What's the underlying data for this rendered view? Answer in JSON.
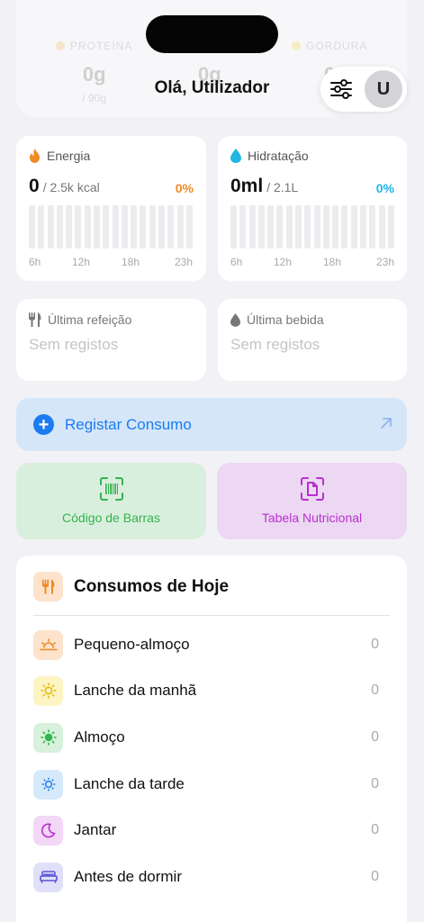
{
  "header": {
    "greeting": "Olá, Utilizador",
    "avatar_initial": "U",
    "faded_macros": [
      {
        "label": "PROTEÍNA",
        "value": "0g",
        "sub": "/ 90g",
        "color": "#f5a623"
      },
      {
        "label": "",
        "value": "0g",
        "sub": "",
        "color": ""
      },
      {
        "label": "GORDURA",
        "value": "0",
        "sub": "",
        "color": "#f5d30a"
      }
    ]
  },
  "energy": {
    "title": "Energia",
    "value": "0",
    "goal": "/ 2.5k kcal",
    "percent": "0%",
    "accent": "#f08a24",
    "axis": [
      "6h",
      "12h",
      "18h",
      "23h"
    ]
  },
  "hydration": {
    "title": "Hidratação",
    "value": "0ml",
    "goal": "/ 2.1L",
    "percent": "0%",
    "accent": "#1fb6e6",
    "axis": [
      "6h",
      "12h",
      "18h",
      "23h"
    ]
  },
  "last_meal": {
    "title": "Última refeição",
    "value": "Sem registos"
  },
  "last_drink": {
    "title": "Última bebida",
    "value": "Sem registos"
  },
  "register": {
    "label": "Registar Consumo",
    "accent": "#1a7cf0"
  },
  "barcode": {
    "label": "Código de Barras",
    "color": "#34b24e",
    "bg": "#d9efdd"
  },
  "nutrition_table": {
    "label": "Tabela Nutricional",
    "color": "#b92fcf",
    "bg": "#ecd8f2"
  },
  "today": {
    "title": "Consumos de Hoje",
    "meals": [
      {
        "name": "Pequeno-almoço",
        "count": "0",
        "icon": "sunrise-icon",
        "bg": "#fde3cc",
        "fg": "#f08a24"
      },
      {
        "name": "Lanche da manhã",
        "count": "0",
        "icon": "sun-icon",
        "bg": "#fdf4c4",
        "fg": "#e8b80a"
      },
      {
        "name": "Almoço",
        "count": "0",
        "icon": "sun-max-icon",
        "bg": "#d7f1dc",
        "fg": "#2fb54a"
      },
      {
        "name": "Lanche da tarde",
        "count": "0",
        "icon": "sun-min-icon",
        "bg": "#d6e9fb",
        "fg": "#1a7cf0"
      },
      {
        "name": "Jantar",
        "count": "0",
        "icon": "moon-icon",
        "bg": "#f2d7f6",
        "fg": "#b92fcf"
      },
      {
        "name": "Antes de dormir",
        "count": "0",
        "icon": "bed-icon",
        "bg": "#e1e0fa",
        "fg": "#5a55d6"
      }
    ]
  }
}
